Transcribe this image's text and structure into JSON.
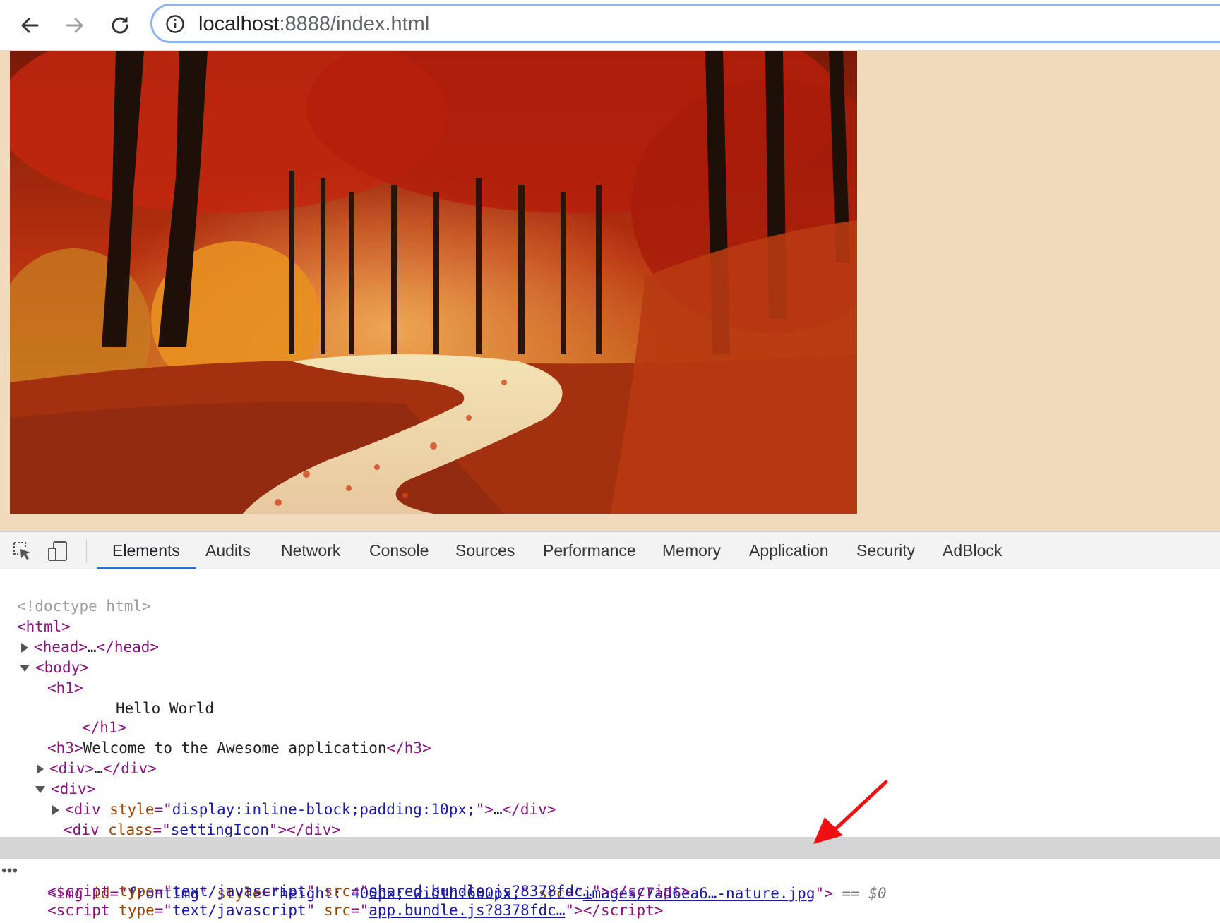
{
  "browser": {
    "url_host": "localhost",
    "url_rest": ":8888/index.html"
  },
  "devtools": {
    "tabs": [
      "Elements",
      "Audits",
      "Network",
      "Console",
      "Sources",
      "Performance",
      "Memory",
      "Application",
      "Security",
      "AdBlock"
    ],
    "active_tab": "Elements",
    "dom": {
      "doctype": "<!doctype html>",
      "html_open": "html",
      "head": "head",
      "body": "body",
      "h1": "h1",
      "h1_text": "Hello World",
      "h3": "h3",
      "h3_text": "Welcome to the Awesome application",
      "div": "div",
      "ellipsis": "…",
      "inline_style_attr": "style",
      "inline_style_val": "display:inline-block;padding:10px;",
      "class_attr": "class",
      "class_val": "settingIcon",
      "img": "img",
      "img_id_attr": "id",
      "img_id_val": "frontImg",
      "img_style_attr": "style",
      "img_style_val": "height: 400px; width:600px;",
      "img_src_attr": "src",
      "img_src_val": "images/7ad6ea6…-nature.jpg",
      "selected_marker": "== $0",
      "script": "script",
      "script_type_attr": "type",
      "script_type_val": "text/javascript",
      "script_src_attr": "src",
      "script1_src": "shared.bundle.js?8378fdc…",
      "script2_src": "app.bundle.js?8378fdc…"
    }
  }
}
